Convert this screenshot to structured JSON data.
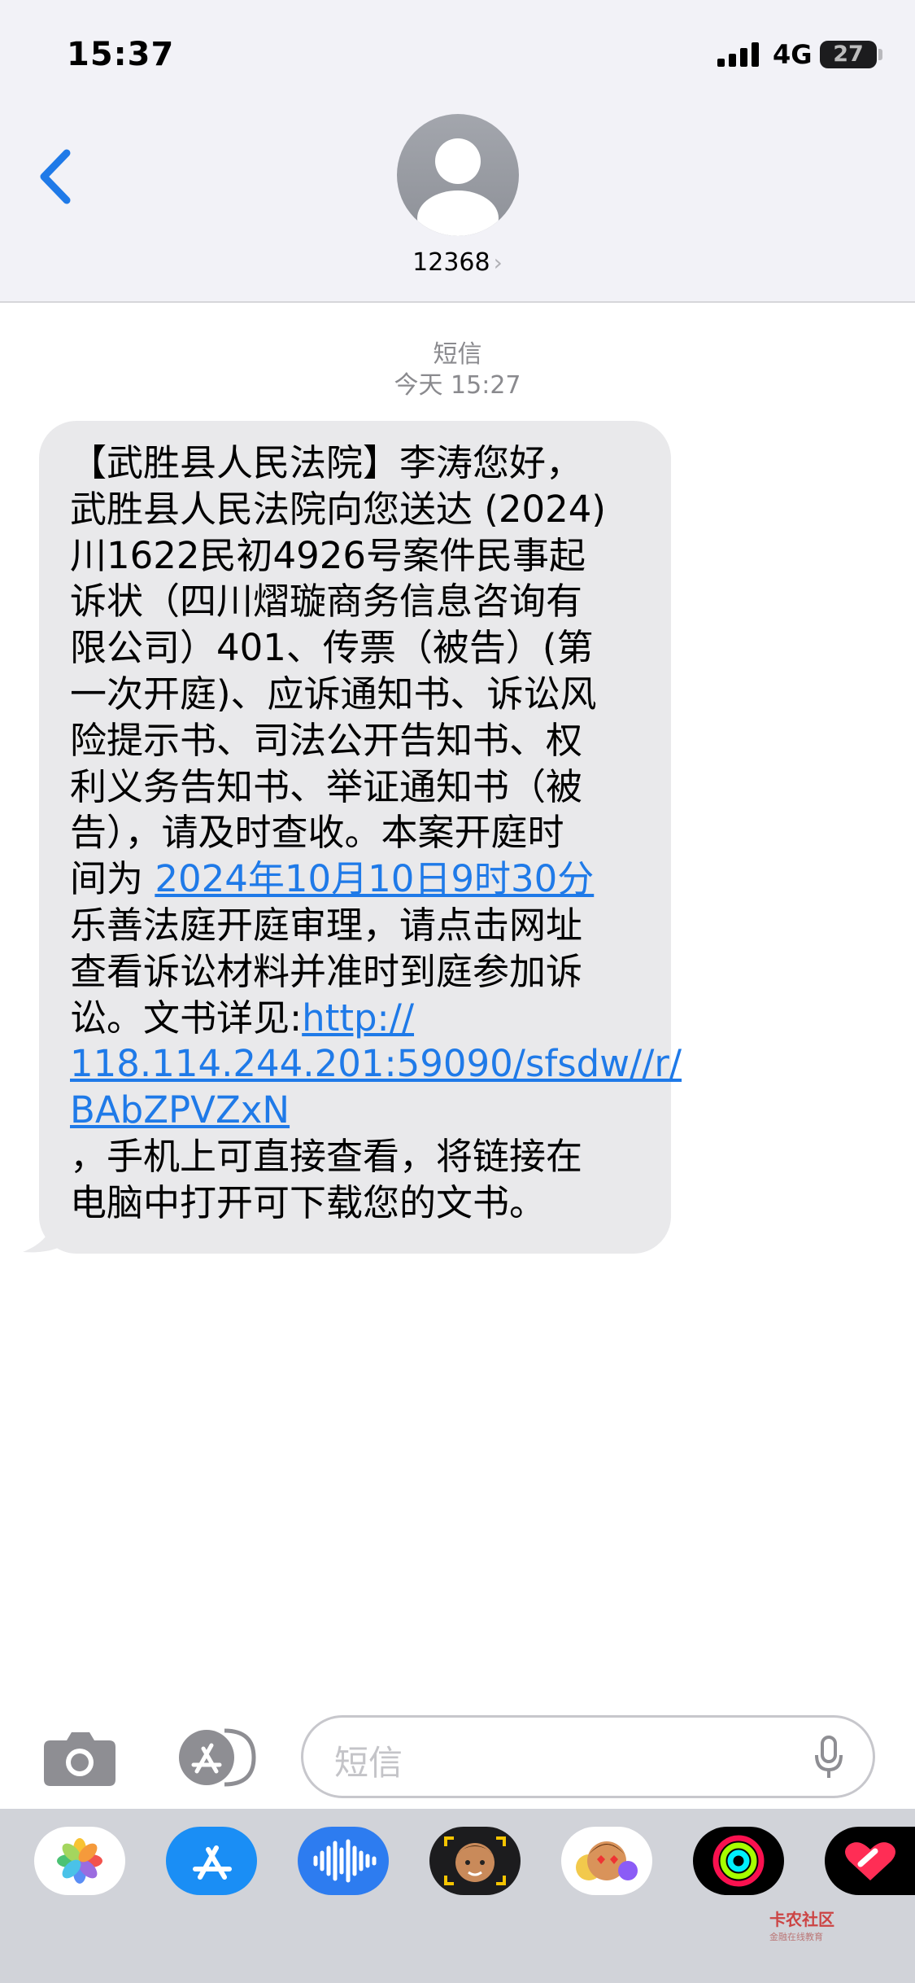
{
  "status_bar": {
    "time": "15:37",
    "network": "4G",
    "battery": "27"
  },
  "header": {
    "contact_name": "12368",
    "back_icon": "chevron-left-icon",
    "chevron": "›"
  },
  "thread": {
    "kind": "短信",
    "timestamp": "今天 15:27"
  },
  "message": {
    "lines": [
      "【武胜县人民法院】李涛您好，",
      "武胜县人民法院向您送达 (2024)",
      "川1622民初4926号案件民事起",
      "诉状（四川熠璇商务信息咨询有",
      "限公司）401、传票（被告）(第",
      "一次开庭)、应诉通知书、诉讼风",
      "险提示书、司法公开告知书、权",
      "利义务告知书、举证通知书（被",
      "告），请及时查收。本案开庭时"
    ],
    "l10_prefix": "间为 ",
    "date_link": "2024年10月10日9时30分",
    "lines_mid": [
      "乐善法庭开庭审理，请点击网址",
      "查看诉讼材料并准时到庭参加诉"
    ],
    "l13_prefix": "讼。文书详见:",
    "url_part1": "http://",
    "url_part2": "118.114.244.201:59090/sfsdw//r/",
    "url_part3": "BAbZPVZxN",
    "lines_end": [
      "，手机上可直接查看，将链接在",
      "电脑中打开可下载您的文书。"
    ]
  },
  "input_bar": {
    "placeholder": "短信"
  },
  "app_drawer": {
    "apps": [
      "photos-icon",
      "app-store-icon",
      "audio-message-icon",
      "memoji-icon",
      "animoji-icon",
      "activity-icon",
      "digital-touch-icon"
    ]
  },
  "watermark": {
    "title": "卡农社区",
    "subtitle": "金融在线教育"
  },
  "colors": {
    "link": "#1f7ae8",
    "bubble": "#e9e9eb",
    "header_bg": "#f2f2f7",
    "drawer_bg": "#d1d3d9"
  }
}
